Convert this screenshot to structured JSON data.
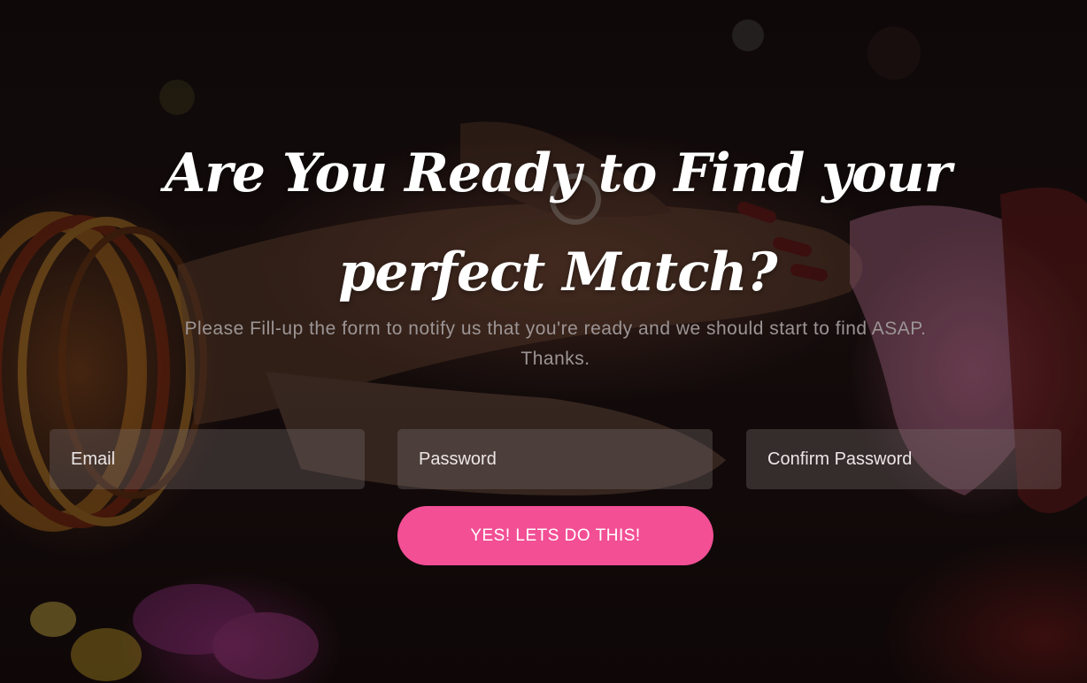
{
  "hero": {
    "headline": "Are You Ready to Find your perfect Match?",
    "subtext": "Please Fill-up the form to notify us that you're ready and we should start to find ASAP. Thanks."
  },
  "form": {
    "email_placeholder": "Email",
    "password_placeholder": "Password",
    "confirm_placeholder": "Confirm Password",
    "submit_label": "YES! LETS DO THIS!"
  },
  "colors": {
    "accent": "#f24f95",
    "headline": "#ffffff",
    "subtext": "#9c9595",
    "field_background": "rgba(120,110,110,0.35)"
  }
}
